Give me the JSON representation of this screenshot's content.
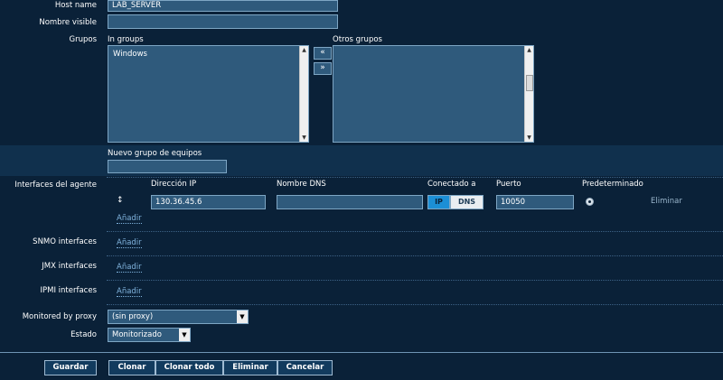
{
  "form": {
    "host_name_label": "Host name",
    "host_name_value": "LAB_SERVER",
    "visible_name_label": "Nombre visible",
    "visible_name_value": "",
    "groups_label": "Grupos",
    "in_groups_label": "In groups",
    "in_groups_items": [
      "Windows"
    ],
    "other_groups_label": "Otros grupos",
    "other_groups_items": [],
    "move_left_label": "«",
    "move_right_label": "»",
    "new_group_label": "Nuevo grupo de equipos",
    "new_group_value": ""
  },
  "interfaces": {
    "agent_label": "Interfaces del agente",
    "col_ip": "Dirección IP",
    "col_dns": "Nombre DNS",
    "col_connect": "Conectado a",
    "col_port": "Puerto",
    "col_default": "Predeterminado",
    "agent_row": {
      "drag_icon": "↕",
      "ip": "130.36.45.6",
      "dns": "",
      "connect_ip": "IP",
      "connect_dns": "DNS",
      "connect_selected": "IP",
      "port": "10050",
      "remove": "Eliminar"
    },
    "add_label": "Añadir",
    "snmp_label": "SNMO interfaces",
    "jmx_label": "JMX interfaces",
    "ipmi_label": "IPMI interfaces"
  },
  "proxy": {
    "label": "Monitored by proxy",
    "value": "(sin proxy)"
  },
  "status": {
    "label": "Estado",
    "value": "Monitorizado"
  },
  "buttons": {
    "save": "Guardar",
    "clone": "Clonar",
    "full_clone": "Clonar todo",
    "delete": "Eliminar",
    "cancel": "Cancelar"
  },
  "colors": {
    "background": "#0a2138",
    "field": "#2f5a7c",
    "field_border": "#7ea6c4",
    "accent_selected": "#1c8fd6",
    "link": "#7fb2dc"
  }
}
